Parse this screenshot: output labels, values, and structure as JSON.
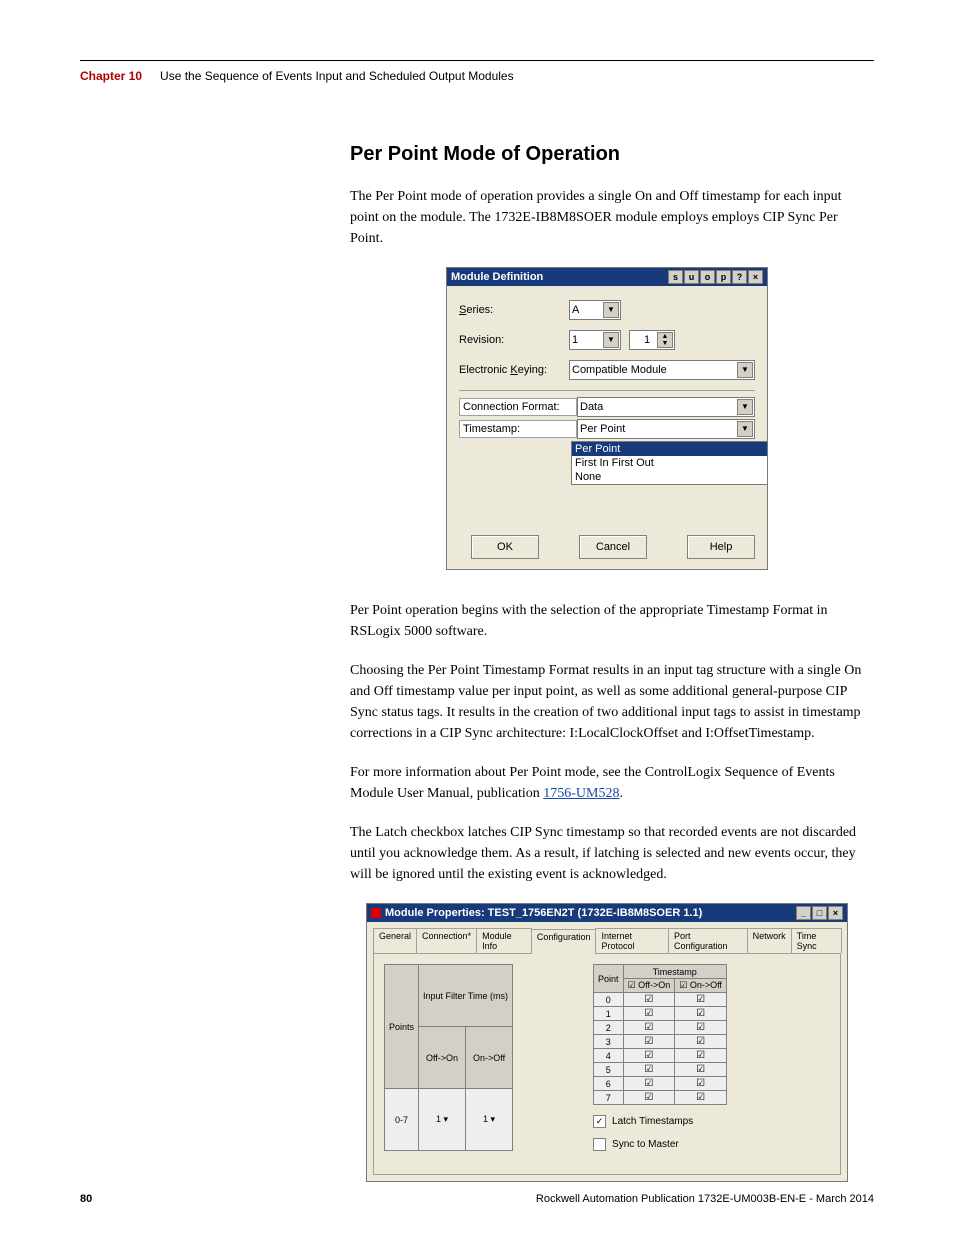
{
  "chapter": {
    "label": "Chapter 10",
    "title": "Use the Sequence of Events Input and Scheduled Output Modules"
  },
  "heading": "Per Point Mode of Operation",
  "p1": "The Per Point mode of operation provides a single On and Off timestamp for each input point on the module. The 1732E-IB8M8SOER module employs employs CIP Sync Per Point.",
  "dialog1": {
    "title": "Module Definition",
    "series_label": "Series:",
    "series_value": "A",
    "revision_label": "Revision:",
    "revision_major": "1",
    "revision_minor": "1",
    "keying_label": "Electronic Keying:",
    "keying_value": "Compatible Module",
    "connfmt_label": "Connection Format:",
    "connfmt_value": "Data",
    "timestamp_label": "Timestamp:",
    "timestamp_value": "Per Point",
    "options": {
      "a": "Per Point",
      "b": "First In First Out",
      "c": "None"
    },
    "ok": "OK",
    "cancel": "Cancel",
    "help": "Help"
  },
  "p2": "Per Point operation begins with the selection of the appropriate Timestamp Format in RSLogix 5000 software.",
  "p3": "Choosing the Per Point Timestamp Format results in an input tag structure with a single On and Off timestamp value per input point, as well as some additional general-purpose CIP Sync status tags. It results in the creation of two additional input tags to assist in timestamp corrections in a CIP Sync architecture: I:LocalClockOffset and I:OffsetTimestamp.",
  "p4a": "For more information about Per Point mode, see the ControlLogix Sequence of Events Module User Manual, publication ",
  "p4link": "1756-UM528",
  "p4b": ".",
  "p5": "The Latch checkbox latches CIP Sync timestamp so that recorded events are not discarded until you acknowledge them. As a result, if latching is selected and new events occur, they will be ignored until the existing event is acknowledged.",
  "dialog2": {
    "title": "Module Properties: TEST_1756EN2T (1732E-IB8M8SOER 1.1)",
    "tabs": {
      "general": "General",
      "connection": "Connection*",
      "modinfo": "Module Info",
      "config": "Configuration",
      "ip": "Internet Protocol",
      "portcfg": "Port Configuration",
      "network": "Network",
      "timesync": "Time Sync"
    },
    "filter_hdr": "Input Filter Time (ms)",
    "points_label": "Points",
    "off_on": "Off->On",
    "on_off": "On->Off",
    "range": "0-7",
    "filter_val": "1",
    "ts_hdr": "Timestamp",
    "point_label": "Point",
    "latch_label": "Latch Timestamps",
    "sync_label": "Sync to Master"
  },
  "footer": {
    "page": "80",
    "pub": "Rockwell Automation Publication 1732E-UM003B-EN-E - March 2014"
  }
}
